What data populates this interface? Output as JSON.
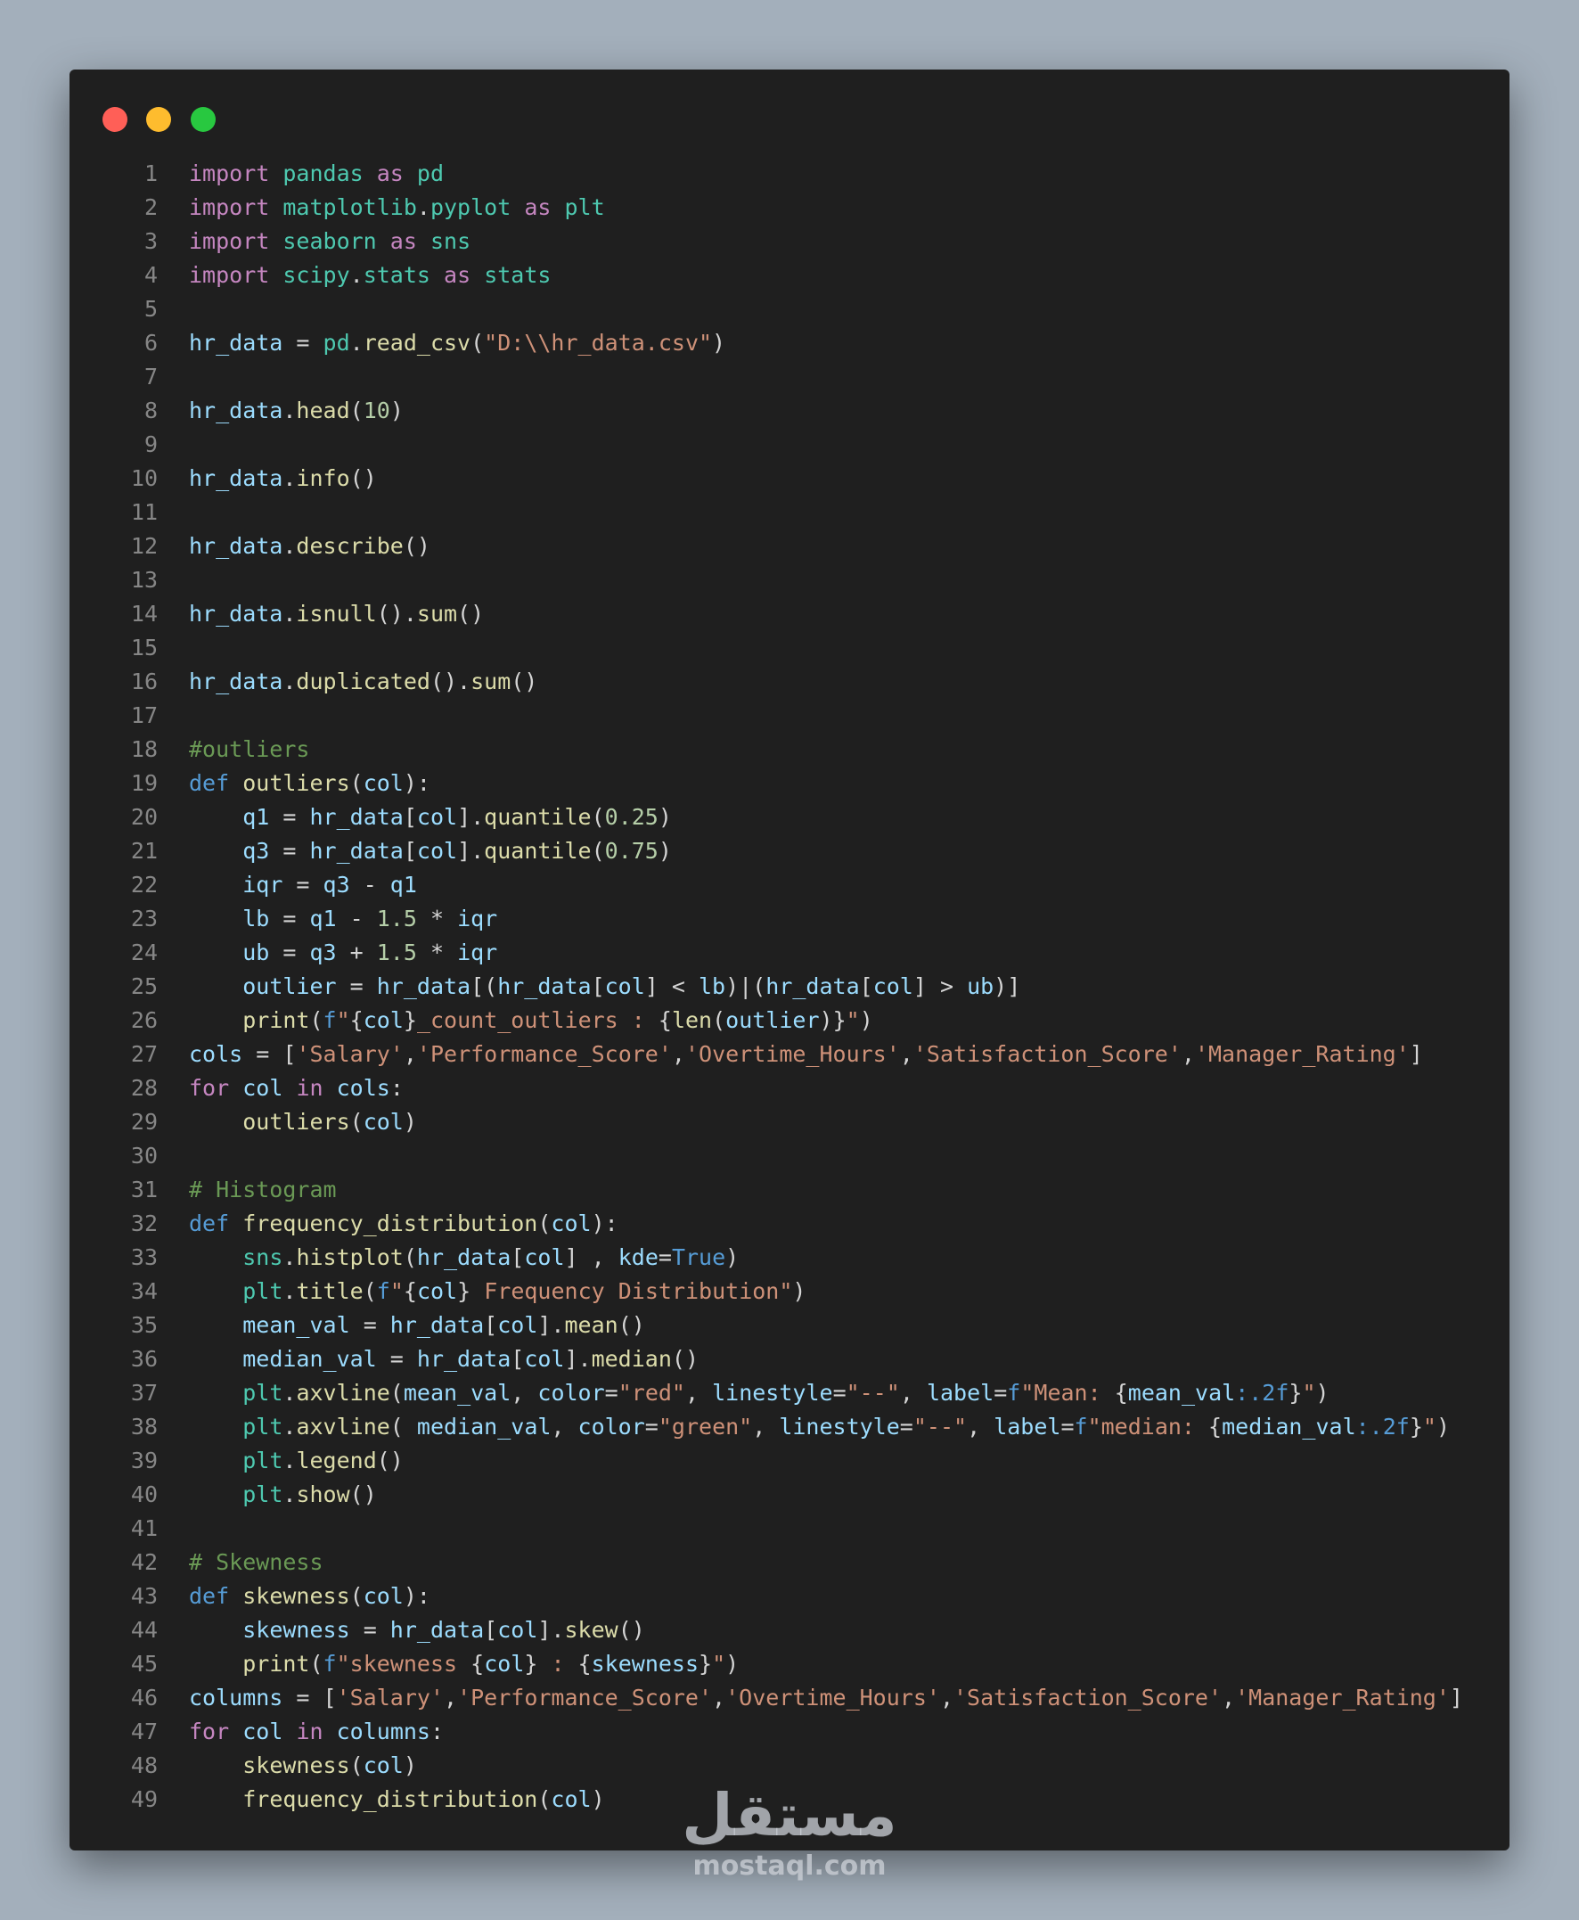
{
  "window": {
    "buttons": [
      "close",
      "minimize",
      "maximize"
    ]
  },
  "code_lines": [
    [
      [
        "import",
        "kw"
      ],
      [
        " ",
        ""
      ],
      [
        "pandas",
        "tp"
      ],
      [
        " ",
        ""
      ],
      [
        "as",
        "kw"
      ],
      [
        " ",
        ""
      ],
      [
        "pd",
        "tp"
      ]
    ],
    [
      [
        "import",
        "kw"
      ],
      [
        " ",
        ""
      ],
      [
        "matplotlib",
        "tp"
      ],
      [
        ".",
        ""
      ],
      [
        "pyplot",
        "tp"
      ],
      [
        " ",
        ""
      ],
      [
        "as",
        "kw"
      ],
      [
        " ",
        ""
      ],
      [
        "plt",
        "tp"
      ]
    ],
    [
      [
        "import",
        "kw"
      ],
      [
        " ",
        ""
      ],
      [
        "seaborn",
        "tp"
      ],
      [
        " ",
        ""
      ],
      [
        "as",
        "kw"
      ],
      [
        " ",
        ""
      ],
      [
        "sns",
        "tp"
      ]
    ],
    [
      [
        "import",
        "kw"
      ],
      [
        " ",
        ""
      ],
      [
        "scipy",
        "tp"
      ],
      [
        ".",
        ""
      ],
      [
        "stats",
        "tp"
      ],
      [
        " ",
        ""
      ],
      [
        "as",
        "kw"
      ],
      [
        " ",
        ""
      ],
      [
        "stats",
        "tp"
      ]
    ],
    [],
    [
      [
        "hr_data",
        "vr"
      ],
      [
        " = ",
        ""
      ],
      [
        "pd",
        "tp"
      ],
      [
        ".",
        ""
      ],
      [
        "read_csv",
        "fn"
      ],
      [
        "(",
        ""
      ],
      [
        "\"D:\\\\hr_data.csv\"",
        "st"
      ],
      [
        ")",
        ""
      ]
    ],
    [],
    [
      [
        "hr_data",
        "vr"
      ],
      [
        ".",
        ""
      ],
      [
        "head",
        "fn"
      ],
      [
        "(",
        ""
      ],
      [
        "10",
        "nm"
      ],
      [
        ")",
        ""
      ]
    ],
    [],
    [
      [
        "hr_data",
        "vr"
      ],
      [
        ".",
        ""
      ],
      [
        "info",
        "fn"
      ],
      [
        "()",
        ""
      ]
    ],
    [],
    [
      [
        "hr_data",
        "vr"
      ],
      [
        ".",
        ""
      ],
      [
        "describe",
        "fn"
      ],
      [
        "()",
        ""
      ]
    ],
    [],
    [
      [
        "hr_data",
        "vr"
      ],
      [
        ".",
        ""
      ],
      [
        "isnull",
        "fn"
      ],
      [
        "().",
        ""
      ],
      [
        "sum",
        "fn"
      ],
      [
        "()",
        ""
      ]
    ],
    [],
    [
      [
        "hr_data",
        "vr"
      ],
      [
        ".",
        ""
      ],
      [
        "duplicated",
        "fn"
      ],
      [
        "().",
        ""
      ],
      [
        "sum",
        "fn"
      ],
      [
        "()",
        ""
      ]
    ],
    [],
    [
      [
        "#outliers",
        "cm"
      ]
    ],
    [
      [
        "def",
        "kb"
      ],
      [
        " ",
        ""
      ],
      [
        "outliers",
        "fn"
      ],
      [
        "(",
        ""
      ],
      [
        "col",
        "vr"
      ],
      [
        "):",
        ""
      ]
    ],
    [
      [
        "    ",
        ""
      ],
      [
        "q1",
        "vr"
      ],
      [
        " = ",
        ""
      ],
      [
        "hr_data",
        "vr"
      ],
      [
        "[",
        ""
      ],
      [
        "col",
        "vr"
      ],
      [
        "].",
        ""
      ],
      [
        "quantile",
        "fn"
      ],
      [
        "(",
        ""
      ],
      [
        "0.25",
        "nm"
      ],
      [
        ")",
        ""
      ]
    ],
    [
      [
        "    ",
        ""
      ],
      [
        "q3",
        "vr"
      ],
      [
        " = ",
        ""
      ],
      [
        "hr_data",
        "vr"
      ],
      [
        "[",
        ""
      ],
      [
        "col",
        "vr"
      ],
      [
        "].",
        ""
      ],
      [
        "quantile",
        "fn"
      ],
      [
        "(",
        ""
      ],
      [
        "0.75",
        "nm"
      ],
      [
        ")",
        ""
      ]
    ],
    [
      [
        "    ",
        ""
      ],
      [
        "iqr",
        "vr"
      ],
      [
        " = ",
        ""
      ],
      [
        "q3",
        "vr"
      ],
      [
        " - ",
        ""
      ],
      [
        "q1",
        "vr"
      ]
    ],
    [
      [
        "    ",
        ""
      ],
      [
        "lb",
        "vr"
      ],
      [
        " = ",
        ""
      ],
      [
        "q1",
        "vr"
      ],
      [
        " - ",
        ""
      ],
      [
        "1.5",
        "nm"
      ],
      [
        " * ",
        ""
      ],
      [
        "iqr",
        "vr"
      ]
    ],
    [
      [
        "    ",
        ""
      ],
      [
        "ub",
        "vr"
      ],
      [
        " = ",
        ""
      ],
      [
        "q3",
        "vr"
      ],
      [
        " + ",
        ""
      ],
      [
        "1.5",
        "nm"
      ],
      [
        " * ",
        ""
      ],
      [
        "iqr",
        "vr"
      ]
    ],
    [
      [
        "    ",
        ""
      ],
      [
        "outlier",
        "vr"
      ],
      [
        " = ",
        ""
      ],
      [
        "hr_data",
        "vr"
      ],
      [
        "[(",
        ""
      ],
      [
        "hr_data",
        "vr"
      ],
      [
        "[",
        ""
      ],
      [
        "col",
        "vr"
      ],
      [
        "] < ",
        ""
      ],
      [
        "lb",
        "vr"
      ],
      [
        ")|(",
        ""
      ],
      [
        "hr_data",
        "vr"
      ],
      [
        "[",
        ""
      ],
      [
        "col",
        "vr"
      ],
      [
        "] > ",
        ""
      ],
      [
        "ub",
        "vr"
      ],
      [
        ")]",
        ""
      ]
    ],
    [
      [
        "    ",
        ""
      ],
      [
        "print",
        "fn"
      ],
      [
        "(",
        ""
      ],
      [
        "f",
        "kb"
      ],
      [
        "\"",
        "st"
      ],
      [
        "{",
        ""
      ],
      [
        "col",
        "vr"
      ],
      [
        "}",
        ""
      ],
      [
        "_count_outliers : ",
        "st"
      ],
      [
        "{",
        ""
      ],
      [
        "len",
        "fn"
      ],
      [
        "(",
        ""
      ],
      [
        "outlier",
        "vr"
      ],
      [
        ")",
        ""
      ],
      [
        "}",
        ""
      ],
      [
        "\"",
        "st"
      ],
      [
        ")",
        ""
      ]
    ],
    [
      [
        "cols",
        "vr"
      ],
      [
        " = [",
        ""
      ],
      [
        "'Salary'",
        "st"
      ],
      [
        ",",
        ""
      ],
      [
        "'Performance_Score'",
        "st"
      ],
      [
        ",",
        ""
      ],
      [
        "'Overtime_Hours'",
        "st"
      ],
      [
        ",",
        ""
      ],
      [
        "'Satisfaction_Score'",
        "st"
      ],
      [
        ",",
        ""
      ],
      [
        "'Manager_Rating'",
        "st"
      ],
      [
        "]",
        ""
      ]
    ],
    [
      [
        "for",
        "kw"
      ],
      [
        " ",
        ""
      ],
      [
        "col",
        "vr"
      ],
      [
        " ",
        ""
      ],
      [
        "in",
        "kw"
      ],
      [
        " ",
        ""
      ],
      [
        "cols",
        "vr"
      ],
      [
        ":",
        ""
      ]
    ],
    [
      [
        "    ",
        ""
      ],
      [
        "outliers",
        "fn"
      ],
      [
        "(",
        ""
      ],
      [
        "col",
        "vr"
      ],
      [
        ")",
        ""
      ]
    ],
    [],
    [
      [
        "# Histogram",
        "cm"
      ]
    ],
    [
      [
        "def",
        "kb"
      ],
      [
        " ",
        ""
      ],
      [
        "frequency_distribution",
        "fn"
      ],
      [
        "(",
        ""
      ],
      [
        "col",
        "vr"
      ],
      [
        "):",
        ""
      ]
    ],
    [
      [
        "    ",
        ""
      ],
      [
        "sns",
        "tp"
      ],
      [
        ".",
        ""
      ],
      [
        "histplot",
        "fn"
      ],
      [
        "(",
        ""
      ],
      [
        "hr_data",
        "vr"
      ],
      [
        "[",
        ""
      ],
      [
        "col",
        "vr"
      ],
      [
        "] , ",
        ""
      ],
      [
        "kde",
        "vr"
      ],
      [
        "=",
        ""
      ],
      [
        "True",
        "kb"
      ],
      [
        ")",
        ""
      ]
    ],
    [
      [
        "    ",
        ""
      ],
      [
        "plt",
        "tp"
      ],
      [
        ".",
        ""
      ],
      [
        "title",
        "fn"
      ],
      [
        "(",
        ""
      ],
      [
        "f",
        "kb"
      ],
      [
        "\"",
        "st"
      ],
      [
        "{",
        ""
      ],
      [
        "col",
        "vr"
      ],
      [
        "}",
        ""
      ],
      [
        " Frequency Distribution\"",
        "st"
      ],
      [
        ")",
        ""
      ]
    ],
    [
      [
        "    ",
        ""
      ],
      [
        "mean_val",
        "vr"
      ],
      [
        " = ",
        ""
      ],
      [
        "hr_data",
        "vr"
      ],
      [
        "[",
        ""
      ],
      [
        "col",
        "vr"
      ],
      [
        "].",
        ""
      ],
      [
        "mean",
        "fn"
      ],
      [
        "()",
        ""
      ]
    ],
    [
      [
        "    ",
        ""
      ],
      [
        "median_val",
        "vr"
      ],
      [
        " = ",
        ""
      ],
      [
        "hr_data",
        "vr"
      ],
      [
        "[",
        ""
      ],
      [
        "col",
        "vr"
      ],
      [
        "].",
        ""
      ],
      [
        "median",
        "fn"
      ],
      [
        "()",
        ""
      ]
    ],
    [
      [
        "    ",
        ""
      ],
      [
        "plt",
        "tp"
      ],
      [
        ".",
        ""
      ],
      [
        "axvline",
        "fn"
      ],
      [
        "(",
        ""
      ],
      [
        "mean_val",
        "vr"
      ],
      [
        ", ",
        ""
      ],
      [
        "color",
        "vr"
      ],
      [
        "=",
        ""
      ],
      [
        "\"red\"",
        "st"
      ],
      [
        ", ",
        ""
      ],
      [
        "linestyle",
        "vr"
      ],
      [
        "=",
        ""
      ],
      [
        "\"--\"",
        "st"
      ],
      [
        ", ",
        ""
      ],
      [
        "label",
        "vr"
      ],
      [
        "=",
        ""
      ],
      [
        "f",
        "kb"
      ],
      [
        "\"Mean: ",
        "st"
      ],
      [
        "{",
        ""
      ],
      [
        "mean_val",
        "vr"
      ],
      [
        ":.2f",
        "kb"
      ],
      [
        "}",
        ""
      ],
      [
        "\"",
        "st"
      ],
      [
        ")",
        ""
      ]
    ],
    [
      [
        "    ",
        ""
      ],
      [
        "plt",
        "tp"
      ],
      [
        ".",
        ""
      ],
      [
        "axvline",
        "fn"
      ],
      [
        "( ",
        ""
      ],
      [
        "median_val",
        "vr"
      ],
      [
        ", ",
        ""
      ],
      [
        "color",
        "vr"
      ],
      [
        "=",
        ""
      ],
      [
        "\"green\"",
        "st"
      ],
      [
        ", ",
        ""
      ],
      [
        "linestyle",
        "vr"
      ],
      [
        "=",
        ""
      ],
      [
        "\"--\"",
        "st"
      ],
      [
        ", ",
        ""
      ],
      [
        "label",
        "vr"
      ],
      [
        "=",
        ""
      ],
      [
        "f",
        "kb"
      ],
      [
        "\"median: ",
        "st"
      ],
      [
        "{",
        ""
      ],
      [
        "median_val",
        "vr"
      ],
      [
        ":.2f",
        "kb"
      ],
      [
        "}",
        ""
      ],
      [
        "\"",
        "st"
      ],
      [
        ")",
        ""
      ]
    ],
    [
      [
        "    ",
        ""
      ],
      [
        "plt",
        "tp"
      ],
      [
        ".",
        ""
      ],
      [
        "legend",
        "fn"
      ],
      [
        "()",
        ""
      ]
    ],
    [
      [
        "    ",
        ""
      ],
      [
        "plt",
        "tp"
      ],
      [
        ".",
        ""
      ],
      [
        "show",
        "fn"
      ],
      [
        "()",
        ""
      ]
    ],
    [],
    [
      [
        "# Skewness",
        "cm"
      ]
    ],
    [
      [
        "def",
        "kb"
      ],
      [
        " ",
        ""
      ],
      [
        "skewness",
        "fn"
      ],
      [
        "(",
        ""
      ],
      [
        "col",
        "vr"
      ],
      [
        "):",
        ""
      ]
    ],
    [
      [
        "    ",
        ""
      ],
      [
        "skewness",
        "vr"
      ],
      [
        " = ",
        ""
      ],
      [
        "hr_data",
        "vr"
      ],
      [
        "[",
        ""
      ],
      [
        "col",
        "vr"
      ],
      [
        "].",
        ""
      ],
      [
        "skew",
        "fn"
      ],
      [
        "()",
        ""
      ]
    ],
    [
      [
        "    ",
        ""
      ],
      [
        "print",
        "fn"
      ],
      [
        "(",
        ""
      ],
      [
        "f",
        "kb"
      ],
      [
        "\"skewness ",
        "st"
      ],
      [
        "{",
        ""
      ],
      [
        "col",
        "vr"
      ],
      [
        "}",
        ""
      ],
      [
        " : ",
        "st"
      ],
      [
        "{",
        ""
      ],
      [
        "skewness",
        "vr"
      ],
      [
        "}",
        ""
      ],
      [
        "\"",
        "st"
      ],
      [
        ")",
        ""
      ]
    ],
    [
      [
        "columns",
        "vr"
      ],
      [
        " = [",
        ""
      ],
      [
        "'Salary'",
        "st"
      ],
      [
        ",",
        ""
      ],
      [
        "'Performance_Score'",
        "st"
      ],
      [
        ",",
        ""
      ],
      [
        "'Overtime_Hours'",
        "st"
      ],
      [
        ",",
        ""
      ],
      [
        "'Satisfaction_Score'",
        "st"
      ],
      [
        ",",
        ""
      ],
      [
        "'Manager_Rating'",
        "st"
      ],
      [
        "]",
        ""
      ]
    ],
    [
      [
        "for",
        "kw"
      ],
      [
        " ",
        ""
      ],
      [
        "col",
        "vr"
      ],
      [
        " ",
        ""
      ],
      [
        "in",
        "kw"
      ],
      [
        " ",
        ""
      ],
      [
        "columns",
        "vr"
      ],
      [
        ":",
        ""
      ]
    ],
    [
      [
        "    ",
        ""
      ],
      [
        "skewness",
        "fn"
      ],
      [
        "(",
        ""
      ],
      [
        "col",
        "vr"
      ],
      [
        ")",
        ""
      ]
    ],
    [
      [
        "    ",
        ""
      ],
      [
        "frequency_distribution",
        "fn"
      ],
      [
        "(",
        ""
      ],
      [
        "col",
        "vr"
      ],
      [
        ")",
        ""
      ]
    ]
  ],
  "watermark": {
    "arabic": "مستقل",
    "latin": "mostaql.com"
  }
}
